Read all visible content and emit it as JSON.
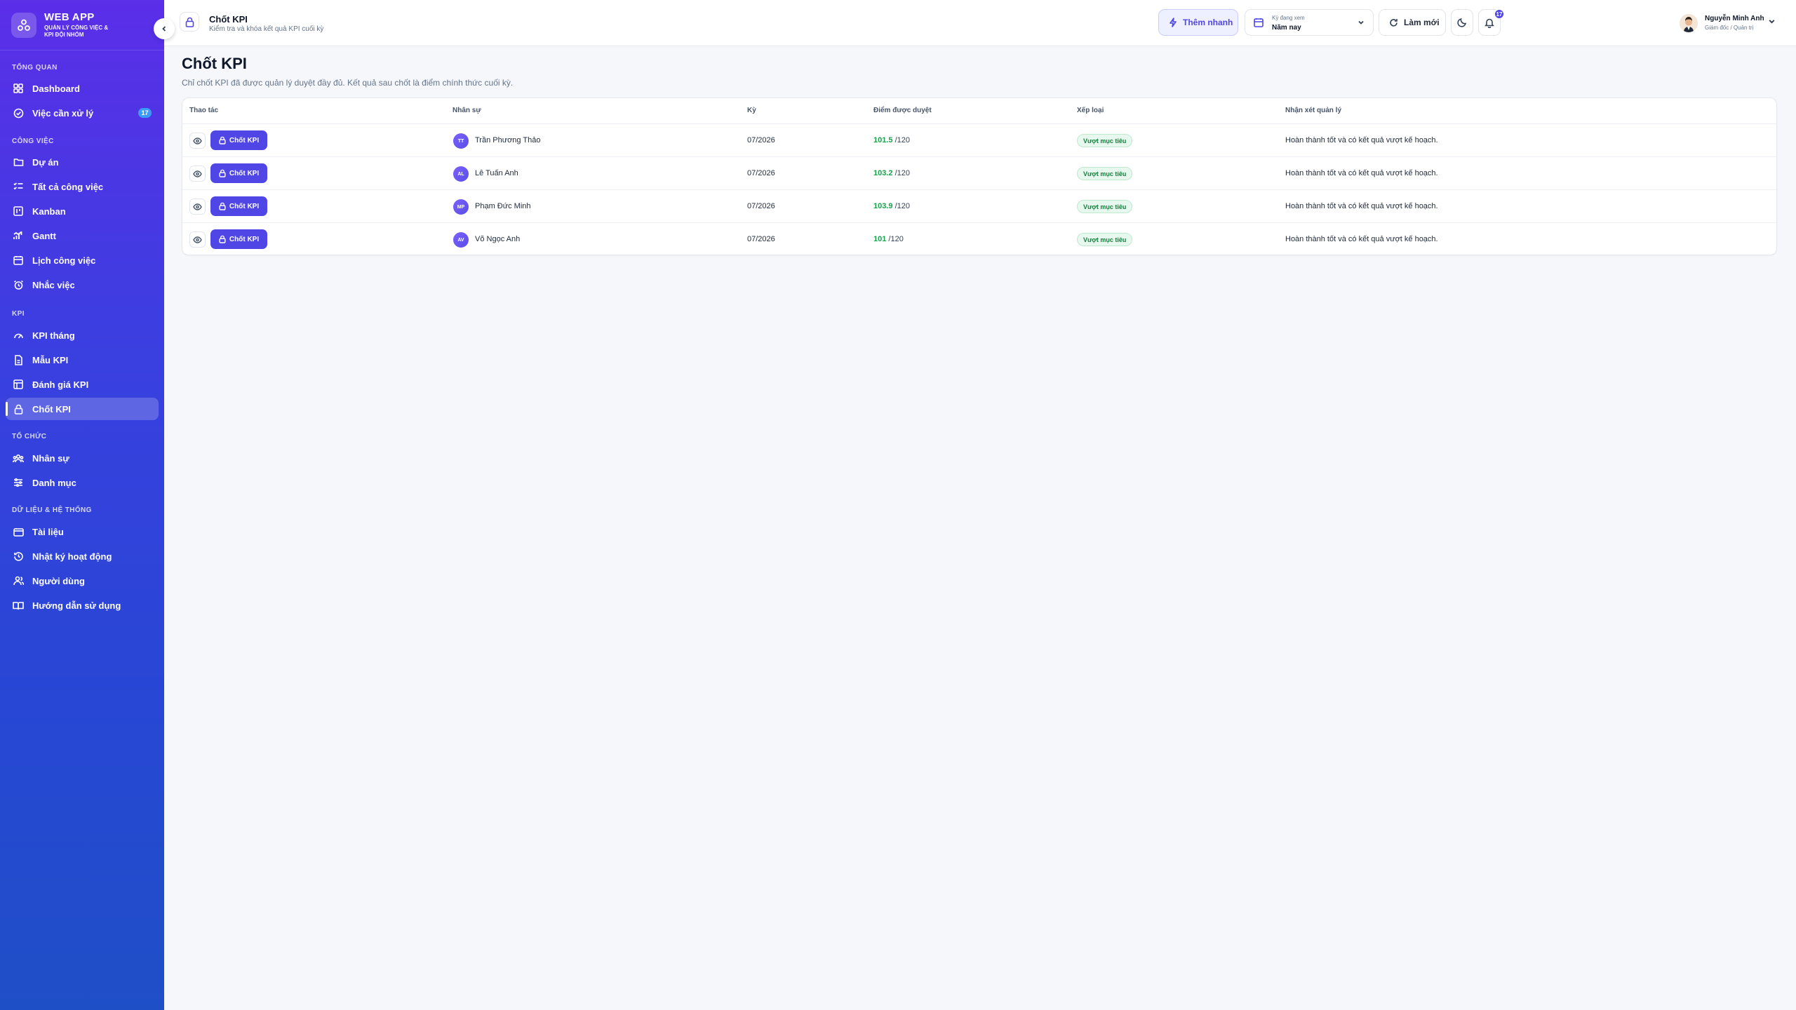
{
  "brand": {
    "title": "WEB APP",
    "subtitle": "QUẢN LÝ CÔNG VIỆC & KPI ĐỘI NHÓM"
  },
  "sidebar": {
    "sections": [
      {
        "label": "TỔNG QUAN"
      },
      {
        "label": "CÔNG VIỆC"
      },
      {
        "label": "KPI"
      },
      {
        "label": "TỔ CHỨC"
      },
      {
        "label": "DỮ LIỆU & HỆ THỐNG"
      }
    ],
    "items": [
      {
        "label": "Dashboard",
        "icon": "dashboard-icon"
      },
      {
        "label": "Việc cần xử lý",
        "icon": "check-circle-icon",
        "badge": "17"
      },
      {
        "label": "Dự án",
        "icon": "folder-icon"
      },
      {
        "label": "Tất cả công việc",
        "icon": "list-check-icon"
      },
      {
        "label": "Kanban",
        "icon": "kanban-icon"
      },
      {
        "label": "Gantt",
        "icon": "gantt-icon"
      },
      {
        "label": "Lịch công việc",
        "icon": "calendar-icon"
      },
      {
        "label": "Nhắc việc",
        "icon": "alarm-icon"
      },
      {
        "label": "KPI tháng",
        "icon": "gauge-icon"
      },
      {
        "label": "Mẫu KPI",
        "icon": "file-icon"
      },
      {
        "label": "Đánh giá KPI",
        "icon": "evaluate-icon"
      },
      {
        "label": "Chốt KPI",
        "icon": "lock-icon",
        "active": true
      },
      {
        "label": "Nhân sự",
        "icon": "users-icon"
      },
      {
        "label": "Danh mục",
        "icon": "sliders-icon"
      },
      {
        "label": "Tài liệu",
        "icon": "document-icon"
      },
      {
        "label": "Nhật ký hoạt động",
        "icon": "history-icon"
      },
      {
        "label": "Người dùng",
        "icon": "user-group-icon"
      },
      {
        "label": "Hướng dẫn sử dụng",
        "icon": "book-icon"
      }
    ]
  },
  "header": {
    "title": "Chốt KPI",
    "subtitle": "Kiểm tra và khóa kết quả KPI cuối kỳ",
    "quick_add": "Thêm nhanh",
    "period_label": "Kỳ đang xem",
    "period_value": "Năm nay",
    "refresh": "Làm mới",
    "notifications": "17",
    "user_name": "Nguyễn Minh Anh",
    "user_role": "Giám đốc / Quản trị"
  },
  "main": {
    "title": "Chốt KPI",
    "description": "Chỉ chốt KPI đã được quản lý duyệt đầy đủ. Kết quả sau chốt là điểm chính thức cuối kỳ.",
    "columns": [
      "Thao tác",
      "Nhân sự",
      "Kỳ",
      "Điểm được duyệt",
      "Xếp loại",
      "Nhận xét quản lý"
    ],
    "action_label": "Chốt KPI",
    "rows": [
      {
        "initials": "TT",
        "name": "Trần Phương Thảo",
        "period": "07/2026",
        "score": "101.5",
        "max": "/120",
        "grade": "Vượt mục tiêu",
        "comment": "Hoàn thành tốt và có kết quả vượt kế hoạch."
      },
      {
        "initials": "AL",
        "name": "Lê Tuấn Anh",
        "period": "07/2026",
        "score": "103.2",
        "max": "/120",
        "grade": "Vượt mục tiêu",
        "comment": "Hoàn thành tốt và có kết quả vượt kế hoạch."
      },
      {
        "initials": "MP",
        "name": "Phạm Đức Minh",
        "period": "07/2026",
        "score": "103.9",
        "max": "/120",
        "grade": "Vượt mục tiêu",
        "comment": "Hoàn thành tốt và có kết quả vượt kế hoạch."
      },
      {
        "initials": "AV",
        "name": "Võ Ngọc Anh",
        "period": "07/2026",
        "score": "101",
        "max": "/120",
        "grade": "Vượt mục tiêu",
        "comment": "Hoàn thành tốt và có kết quả vượt kế hoạch."
      }
    ]
  },
  "colors": {
    "accent": "#4f46e5",
    "sidebar_top": "#5b2ee8",
    "sidebar_bottom": "#1f4fc7",
    "score": "#16a34a",
    "badge_bg": "#e7f8ee"
  }
}
